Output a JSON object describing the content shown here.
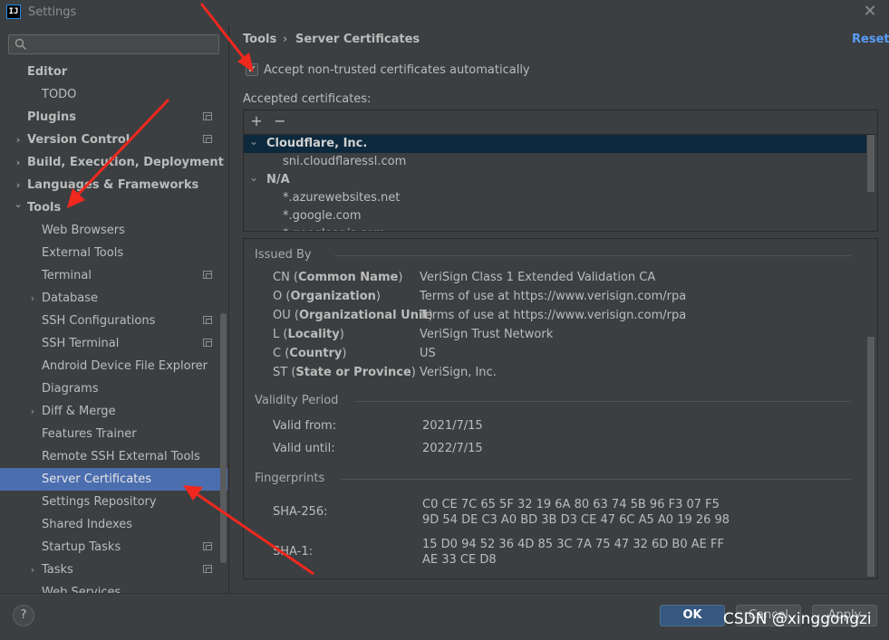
{
  "window": {
    "app_icon_text": "IJ",
    "title": "Settings",
    "close_icon": "close-icon"
  },
  "sidebar": {
    "search_placeholder": "",
    "items": [
      {
        "label": "Editor",
        "bold": true
      },
      {
        "label": "TODO"
      },
      {
        "label": "Plugins",
        "bold": true
      },
      {
        "label": "Version Control",
        "bold": true
      },
      {
        "label": "Build, Execution, Deployment",
        "bold": true
      },
      {
        "label": "Languages & Frameworks",
        "bold": true
      },
      {
        "label": "Tools",
        "bold": true
      },
      {
        "label": "Web Browsers"
      },
      {
        "label": "External Tools"
      },
      {
        "label": "Terminal"
      },
      {
        "label": "Database"
      },
      {
        "label": "SSH Configurations"
      },
      {
        "label": "SSH Terminal"
      },
      {
        "label": "Android Device File Explorer"
      },
      {
        "label": "Diagrams"
      },
      {
        "label": "Diff & Merge"
      },
      {
        "label": "Features Trainer"
      },
      {
        "label": "Remote SSH External Tools"
      },
      {
        "label": "Server Certificates",
        "selected": true
      },
      {
        "label": "Settings Repository"
      },
      {
        "label": "Shared Indexes"
      },
      {
        "label": "Startup Tasks"
      },
      {
        "label": "Tasks"
      },
      {
        "label": "Web Services"
      }
    ]
  },
  "header": {
    "breadcrumb_parent": "Tools",
    "breadcrumb_sep": "›",
    "breadcrumb_current": "Server Certificates",
    "reset_label": "Reset"
  },
  "options": {
    "accept_untrusted_label": "Accept non-trusted certificates automatically",
    "accept_untrusted_checked": true
  },
  "certificates": {
    "section_label": "Accepted certificates:",
    "add_label": "+",
    "remove_label": "−",
    "tree": [
      {
        "group": "Cloudflare, Inc.",
        "expanded": true,
        "selected": true,
        "children": [
          "sni.cloudflaressl.com"
        ]
      },
      {
        "group": "N/A",
        "expanded": true,
        "children": [
          "*.azurewebsites.net",
          "*.google.com",
          "*.googleapis.com"
        ]
      }
    ]
  },
  "details": {
    "issued_by": {
      "heading": "Issued By",
      "rows": [
        {
          "key_prefix": "CN (",
          "key_bold": "Common Name",
          "key_suffix": ")",
          "value": "VeriSign Class 1 Extended Validation CA"
        },
        {
          "key_prefix": "O (",
          "key_bold": "Organization",
          "key_suffix": ")",
          "value": "Terms of use at https://www.verisign.com/rpa"
        },
        {
          "key_prefix": "OU (",
          "key_bold": "Organizational Unit",
          "key_suffix": ")",
          "value": "Terms of use at https://www.verisign.com/rpa"
        },
        {
          "key_prefix": "L (",
          "key_bold": "Locality",
          "key_suffix": ")",
          "value": "VeriSign Trust Network"
        },
        {
          "key_prefix": "C (",
          "key_bold": "Country",
          "key_suffix": ")",
          "value": "US"
        },
        {
          "key_prefix": "ST (",
          "key_bold": "State or Province",
          "key_suffix": ")",
          "value": "VeriSign, Inc."
        }
      ]
    },
    "validity": {
      "heading": "Validity Period",
      "valid_from_label": "Valid from:",
      "valid_from": "2021/7/15",
      "valid_until_label": "Valid until:",
      "valid_until": "2022/7/15"
    },
    "fingerprints": {
      "heading": "Fingerprints",
      "sha256_label": "SHA-256:",
      "sha256_line1": "C0 CE 7C 65 5F 32 19 6A 80 63 74 5B 96 F3 07 F5",
      "sha256_line2": "9D 54 DE C3 A0 BD 3B D3 CE 47 6C A5 A0 19 26 98",
      "sha1_label": "SHA-1:",
      "sha1_line1": "15 D0 94 52 36 4D 85 3C 7A 75 47 32 6D B0 AE FF",
      "sha1_line2": "AE 33 CE D8"
    }
  },
  "footer": {
    "help_label": "?",
    "ok_label": "OK",
    "cancel_label": "Cancel",
    "apply_label": "Apply"
  },
  "watermark": "CSDN @xinggongzi",
  "colors": {
    "accent": "#4b6eaf",
    "link": "#589df6",
    "annotation_arrow": "#f0281e",
    "background": "#3c3f41"
  }
}
